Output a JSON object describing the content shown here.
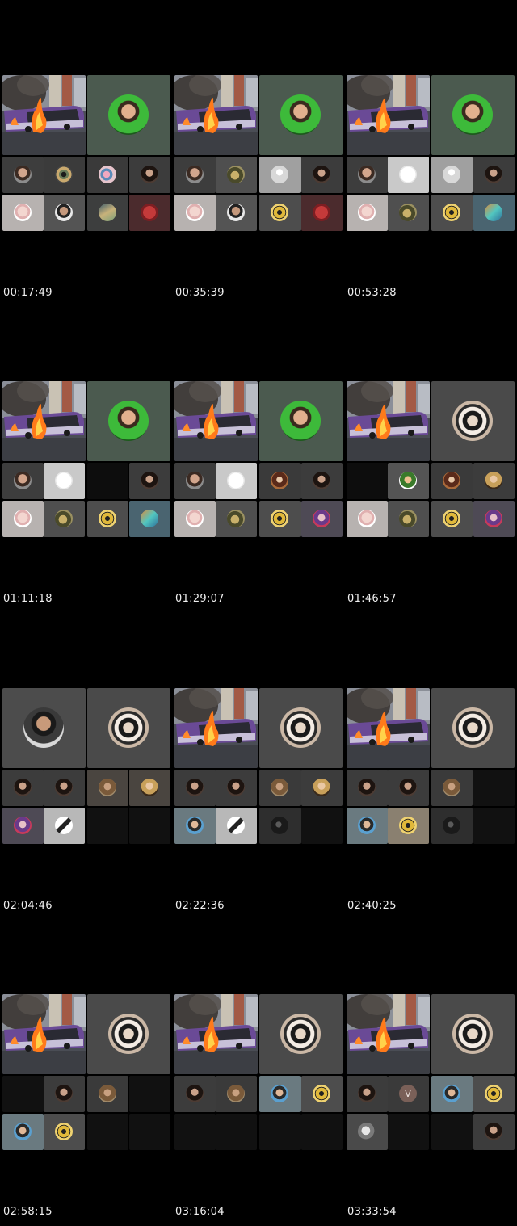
{
  "frames": [
    {
      "timestamp": "00:17:49",
      "left": "bus",
      "right": "green",
      "tiles": [
        {
          "bg": "#3d3d3d",
          "av": "man"
        },
        {
          "bg": "#3b3b3b",
          "av": "eye"
        },
        {
          "bg": "#3a3a3a",
          "av": "flower"
        },
        {
          "bg": "#3c3c3c",
          "av": "woman"
        },
        {
          "bg": "#b7b2b0",
          "av": "pale"
        },
        {
          "bg": "#545454",
          "av": "man2"
        },
        {
          "bg": "#3d3e3e",
          "av": "wave"
        },
        {
          "bg": "#4b2b2d",
          "av": "cross"
        }
      ]
    },
    {
      "timestamp": "00:35:39",
      "left": "bus",
      "right": "green",
      "tiles": [
        {
          "bg": "#3d3d3d",
          "av": "man"
        },
        {
          "bg": "#4f4f4f",
          "av": "bird"
        },
        {
          "bg": "#a0a0a0",
          "av": "default"
        },
        {
          "bg": "#3c3c3c",
          "av": "woman"
        },
        {
          "bg": "#b7b2b0",
          "av": "pale"
        },
        {
          "bg": "#545454",
          "av": "man2"
        },
        {
          "bg": "#4d4d4d",
          "av": "wolverine"
        },
        {
          "bg": "#4b2b2d",
          "av": "cross"
        }
      ]
    },
    {
      "timestamp": "00:53:28",
      "left": "bus",
      "right": "green",
      "tiles": [
        {
          "bg": "#3d3d3d",
          "av": "man"
        },
        {
          "bg": "#c9c9c9",
          "av": "white"
        },
        {
          "bg": "#a0a0a0",
          "av": "default"
        },
        {
          "bg": "#3c3c3c",
          "av": "woman"
        },
        {
          "bg": "#b7b2b0",
          "av": "pale"
        },
        {
          "bg": "#4f4f4f",
          "av": "bird"
        },
        {
          "bg": "#4d4d4d",
          "av": "wolverine"
        },
        {
          "bg": "#4a6470",
          "av": "teal"
        }
      ]
    },
    {
      "timestamp": "01:11:18",
      "left": "bus",
      "right": "green",
      "tiles": [
        {
          "bg": "#3d3d3d",
          "av": "man"
        },
        {
          "bg": "#c9c9c9",
          "av": "white"
        },
        {
          "bg": "#0d0d0d",
          "av": ""
        },
        {
          "bg": "#3c3c3c",
          "av": "woman"
        },
        {
          "bg": "#b7b2b0",
          "av": "pale"
        },
        {
          "bg": "#4f4f4f",
          "av": "bird"
        },
        {
          "bg": "#4d4d4d",
          "av": "wolverine"
        },
        {
          "bg": "#4a6470",
          "av": "teal"
        }
      ]
    },
    {
      "timestamp": "01:29:07",
      "left": "bus",
      "right": "green",
      "tiles": [
        {
          "bg": "#3d3d3d",
          "av": "man"
        },
        {
          "bg": "#c9c9c9",
          "av": "white"
        },
        {
          "bg": "#3a3a3a",
          "av": "brown"
        },
        {
          "bg": "#3c3c3c",
          "av": "woman"
        },
        {
          "bg": "#b7b2b0",
          "av": "pale"
        },
        {
          "bg": "#4f4f4f",
          "av": "bird"
        },
        {
          "bg": "#4d4d4d",
          "av": "wolverine"
        },
        {
          "bg": "#4e4a55",
          "av": "purple"
        }
      ]
    },
    {
      "timestamp": "01:46:57",
      "left": "bus",
      "right": "mask",
      "tiles": [
        {
          "bg": "#0d0d0d",
          "av": ""
        },
        {
          "bg": "#545454",
          "av": "kid"
        },
        {
          "bg": "#3a3a3a",
          "av": "brown"
        },
        {
          "bg": "#3c3c3c",
          "av": "gold"
        },
        {
          "bg": "#b7b2b0",
          "av": "pale"
        },
        {
          "bg": "#4f4f4f",
          "av": "bird"
        },
        {
          "bg": "#4d4d4d",
          "av": "wolverine"
        },
        {
          "bg": "#4e4a55",
          "av": "purple"
        }
      ]
    },
    {
      "timestamp": "02:04:46",
      "left": "portrait",
      "right": "mask",
      "tiles": [
        {
          "bg": "#3c3c3c",
          "av": "woman"
        },
        {
          "bg": "#3c3c3c",
          "av": "woman"
        },
        {
          "bg": "#4a4540",
          "av": "curly"
        },
        {
          "bg": "#4a4540",
          "av": "gold"
        },
        {
          "bg": "#4e4a55",
          "av": "purple"
        },
        {
          "bg": "#b8b8b8",
          "av": "bw"
        },
        {
          "bg": "#111",
          "av": ""
        },
        {
          "bg": "#111",
          "av": ""
        }
      ]
    },
    {
      "timestamp": "02:22:36",
      "left": "bus",
      "right": "mask",
      "tiles": [
        {
          "bg": "#3c3c3c",
          "av": "woman"
        },
        {
          "bg": "#3c3c3c",
          "av": "woman"
        },
        {
          "bg": "#3a3a3a",
          "av": "curly"
        },
        {
          "bg": "#3c3c3c",
          "av": "gold"
        },
        {
          "bg": "#6a7a80",
          "av": "blueman"
        },
        {
          "bg": "#b8b8b8",
          "av": "bw"
        },
        {
          "bg": "#2e2e2e",
          "av": "dark"
        },
        {
          "bg": "#111",
          "av": ""
        }
      ]
    },
    {
      "timestamp": "02:40:25",
      "left": "bus",
      "right": "mask",
      "tiles": [
        {
          "bg": "#3c3c3c",
          "av": "woman"
        },
        {
          "bg": "#3c3c3c",
          "av": "woman"
        },
        {
          "bg": "#3a3a3a",
          "av": "curly"
        },
        {
          "bg": "#111",
          "av": ""
        },
        {
          "bg": "#6a7a80",
          "av": "blueman"
        },
        {
          "bg": "#8a8070",
          "av": "wolverine"
        },
        {
          "bg": "#2e2e2e",
          "av": "dark"
        },
        {
          "bg": "#111",
          "av": ""
        }
      ]
    },
    {
      "timestamp": "02:58:15",
      "left": "bus",
      "right": "mask",
      "tiles": [
        {
          "bg": "#111",
          "av": ""
        },
        {
          "bg": "#3c3c3c",
          "av": "woman"
        },
        {
          "bg": "#3a3a3a",
          "av": "curly"
        },
        {
          "bg": "#111",
          "av": ""
        },
        {
          "bg": "#6a7a80",
          "av": "blueman"
        },
        {
          "bg": "#4d4d4d",
          "av": "wolverine"
        },
        {
          "bg": "#111",
          "av": ""
        },
        {
          "bg": "#111",
          "av": ""
        }
      ]
    },
    {
      "timestamp": "03:16:04",
      "left": "bus",
      "right": "mask",
      "tiles": [
        {
          "bg": "#3c3c3c",
          "av": "woman"
        },
        {
          "bg": "#3a3a3a",
          "av": "curly"
        },
        {
          "bg": "#6a7a80",
          "av": "blueman"
        },
        {
          "bg": "#4d4d4d",
          "av": "wolverine"
        },
        {
          "bg": "#111",
          "av": ""
        },
        {
          "bg": "#111",
          "av": ""
        },
        {
          "bg": "#111",
          "av": ""
        },
        {
          "bg": "#111",
          "av": ""
        }
      ]
    },
    {
      "timestamp": "03:33:54",
      "left": "bus",
      "right": "mask",
      "tiles": [
        {
          "bg": "#3c3c3c",
          "av": "woman"
        },
        {
          "bg": "#3a3a3a",
          "av": "letter",
          "letter": "V"
        },
        {
          "bg": "#6a7a80",
          "av": "blueman"
        },
        {
          "bg": "#4d4d4d",
          "av": "wolverine"
        },
        {
          "bg": "#4a4a4a",
          "av": "helmet"
        },
        {
          "bg": "#111",
          "av": ""
        },
        {
          "bg": "#111",
          "av": ""
        },
        {
          "bg": "#3c3c3c",
          "av": "woman"
        }
      ]
    }
  ]
}
